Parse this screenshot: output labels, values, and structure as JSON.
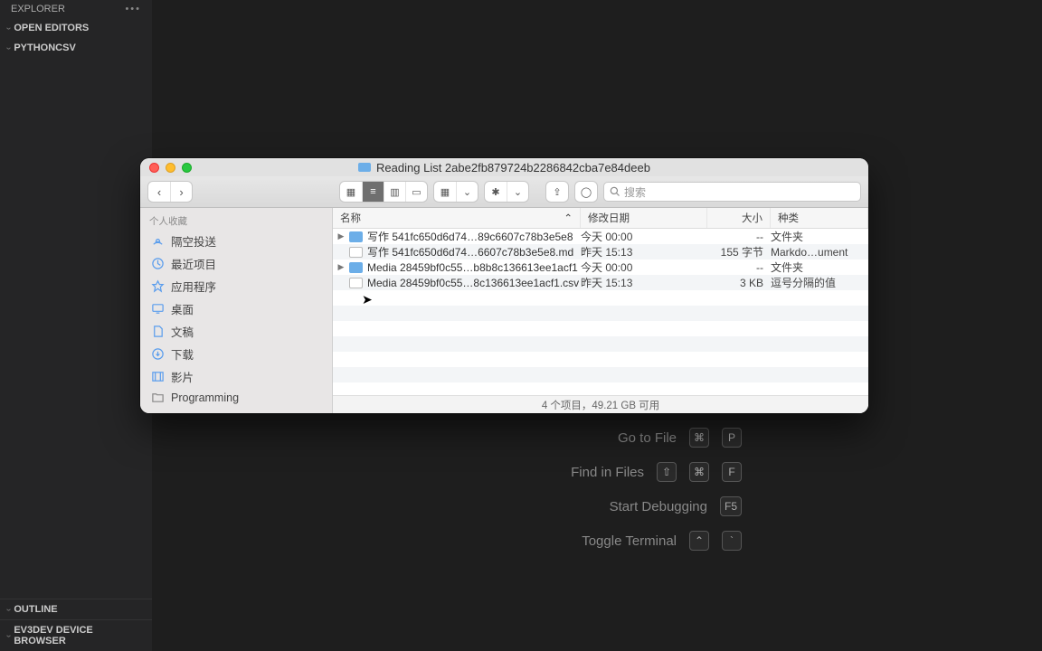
{
  "vscode": {
    "explorer": "EXPLORER",
    "open_editors": "OPEN EDITORS",
    "project": "PYTHONCSV",
    "outline": "OUTLINE",
    "ev3": "EV3DEV DEVICE BROWSER",
    "hints": {
      "gotofile": "Go to File",
      "gotofile_k1": "⌘",
      "gotofile_k2": "P",
      "findfiles": "Find in Files",
      "findfiles_k1": "⇧",
      "findfiles_k2": "⌘",
      "findfiles_k3": "F",
      "debug": "Start Debugging",
      "debug_k": "F5",
      "terminal": "Toggle Terminal",
      "terminal_k1": "⌃",
      "terminal_k2": "`"
    }
  },
  "finder": {
    "title": "Reading List 2abe2fb879724b2286842cba7e84deeb",
    "search_placeholder": "搜索",
    "sidebar_header": "个人收藏",
    "favorites": {
      "airdrop": "隔空投送",
      "recents": "最近项目",
      "apps": "应用程序",
      "desktop": "桌面",
      "documents": "文稿",
      "downloads": "下载",
      "movies": "影片",
      "programming": "Programming"
    },
    "columns": {
      "name": "名称",
      "date": "修改日期",
      "size": "大小",
      "kind": "种类"
    },
    "rows": [
      {
        "name": "写作 541fc650d6d74…89c6607c78b3e5e8",
        "date": "今天 00:00",
        "size": "--",
        "kind": "文件夹",
        "icon": "folder",
        "expandable": true
      },
      {
        "name": "写作 541fc650d6d74…6607c78b3e5e8.md",
        "date": "昨天 15:13",
        "size": "155 字节",
        "kind": "Markdo…ument",
        "icon": "file",
        "expandable": false
      },
      {
        "name": "Media 28459bf0c55…b8b8c136613ee1acf1",
        "date": "今天 00:00",
        "size": "--",
        "kind": "文件夹",
        "icon": "folder",
        "expandable": true
      },
      {
        "name": "Media 28459bf0c55…8c136613ee1acf1.csv",
        "date": "昨天 15:13",
        "size": "3 KB",
        "kind": "逗号分隔的值",
        "icon": "file",
        "expandable": false
      }
    ],
    "status": "4 个项目，49.21 GB 可用"
  }
}
